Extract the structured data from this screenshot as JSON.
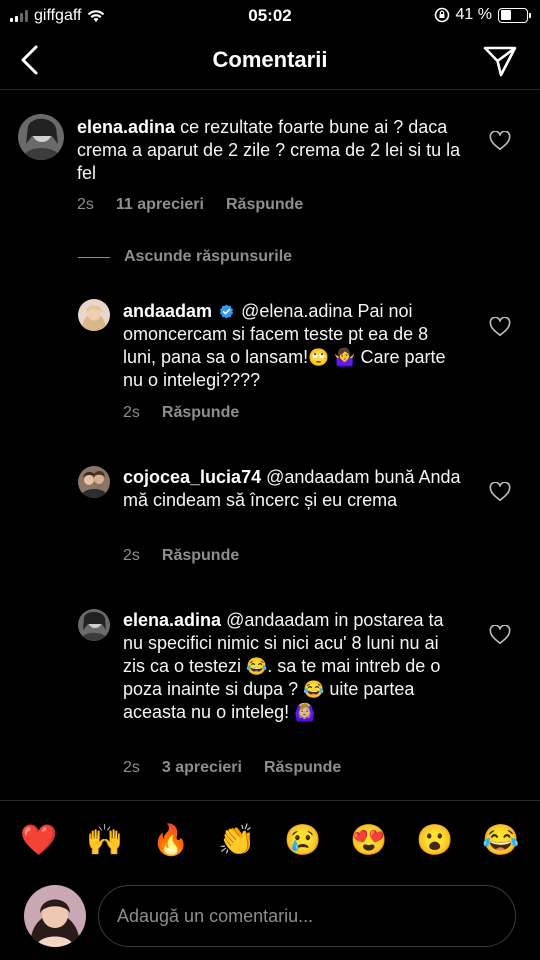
{
  "status_bar": {
    "carrier": "giffgaff",
    "time": "05:02",
    "battery_text": "41 %",
    "battery_level": 0.41
  },
  "header": {
    "title": "Comentarii"
  },
  "comments": [
    {
      "username": "elena.adina",
      "text": "ce rezultate foarte bune ai ? daca crema a aparut de 2 zile ?  crema de 2 lei si tu la fel",
      "time": "2s",
      "likes": "11 aprecieri",
      "reply_label": "Răspunde"
    }
  ],
  "hide_replies_label": "Ascunde răspunsurile",
  "replies": [
    {
      "username": "andaadam",
      "mention": "@elena.adina",
      "text_1": "Pai noi omoncercam si facem teste pt ea de 8 luni, pana sa o lansam!",
      "emoji_1": "🙄",
      "emoji_2": "🤷‍♀️",
      "text_2": "Care parte nu o intelegi????",
      "time": "2s",
      "reply_label": "Răspunde"
    },
    {
      "username": "cojocea_lucia74",
      "mention": "@andaadam",
      "text": "bună Anda mă cindeam să încerc și eu crema",
      "time": "2s",
      "reply_label": "Răspunde"
    },
    {
      "username": "elena.adina",
      "mention": "@andaadam",
      "text_1": " in postarea ta nu specifici nimic si nici acu' 8 luni nu ai zis ca o testezi",
      "emoji_1": "😂",
      "text_2": ". sa te mai intreb de o poza inainte si dupa ?",
      "emoji_2": "😂",
      "text_3": "uite partea aceasta nu o inteleg!",
      "emoji_3": "🙆🏼‍♀️",
      "time": "2s",
      "likes": "3 aprecieri",
      "reply_label": "Răspunde"
    }
  ],
  "quick_emojis": [
    "❤️",
    "🙌",
    "🔥",
    "👏",
    "😢",
    "😍",
    "😮",
    "😂"
  ],
  "composer": {
    "placeholder": "Adaugă un comentariu..."
  },
  "icons": {
    "back": "chevron-left-icon",
    "share": "paper-plane-icon",
    "like": "heart-outline-icon",
    "verified": "verified-badge-icon"
  },
  "colors": {
    "background": "#000000",
    "secondary_text": "#8e8e8e",
    "verified_blue": "#3897f0",
    "divider": "#262626"
  }
}
